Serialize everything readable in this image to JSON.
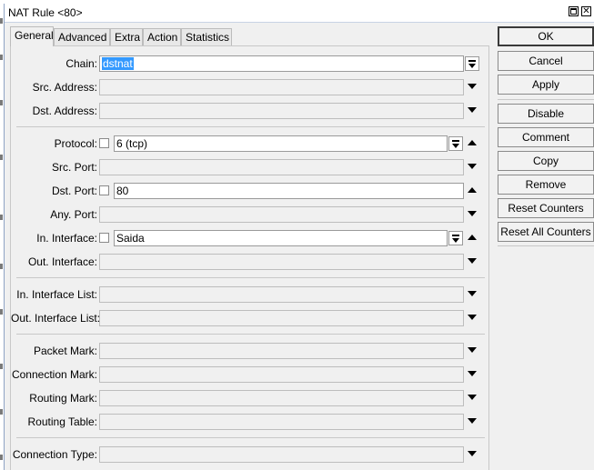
{
  "window": {
    "title": "NAT Rule <80>",
    "maximize_icon": "maximize-icon",
    "close_icon": "close-icon",
    "close_glyph": "✕"
  },
  "tabs": [
    {
      "label": "General",
      "active": true
    },
    {
      "label": "Advanced",
      "active": false
    },
    {
      "label": "Extra",
      "active": false
    },
    {
      "label": "Action",
      "active": false
    },
    {
      "label": "Statistics",
      "active": false
    }
  ],
  "fields": {
    "chain": {
      "label": "Chain:",
      "value": "dstnat"
    },
    "src_address": {
      "label": "Src. Address:",
      "value": ""
    },
    "dst_address": {
      "label": "Dst. Address:",
      "value": ""
    },
    "protocol": {
      "label": "Protocol:",
      "value": "6 (tcp)"
    },
    "src_port": {
      "label": "Src. Port:",
      "value": ""
    },
    "dst_port": {
      "label": "Dst. Port:",
      "value": "80"
    },
    "any_port": {
      "label": "Any. Port:",
      "value": ""
    },
    "in_interface": {
      "label": "In. Interface:",
      "value": "Saida"
    },
    "out_interface": {
      "label": "Out. Interface:",
      "value": ""
    },
    "in_interface_list": {
      "label": "In. Interface List:",
      "value": ""
    },
    "out_interface_list": {
      "label": "Out. Interface List:",
      "value": ""
    },
    "packet_mark": {
      "label": "Packet Mark:",
      "value": ""
    },
    "connection_mark": {
      "label": "Connection Mark:",
      "value": ""
    },
    "routing_mark": {
      "label": "Routing Mark:",
      "value": ""
    },
    "routing_table": {
      "label": "Routing Table:",
      "value": ""
    },
    "connection_type": {
      "label": "Connection Type:",
      "value": ""
    }
  },
  "buttons": {
    "ok": "OK",
    "cancel": "Cancel",
    "apply": "Apply",
    "disable": "Disable",
    "comment": "Comment",
    "copy": "Copy",
    "remove": "Remove",
    "reset_counters": "Reset Counters",
    "reset_all_counters": "Reset All Counters"
  },
  "colors": {
    "selection": "#3399ff",
    "window_bg": "#f0f0f0"
  }
}
